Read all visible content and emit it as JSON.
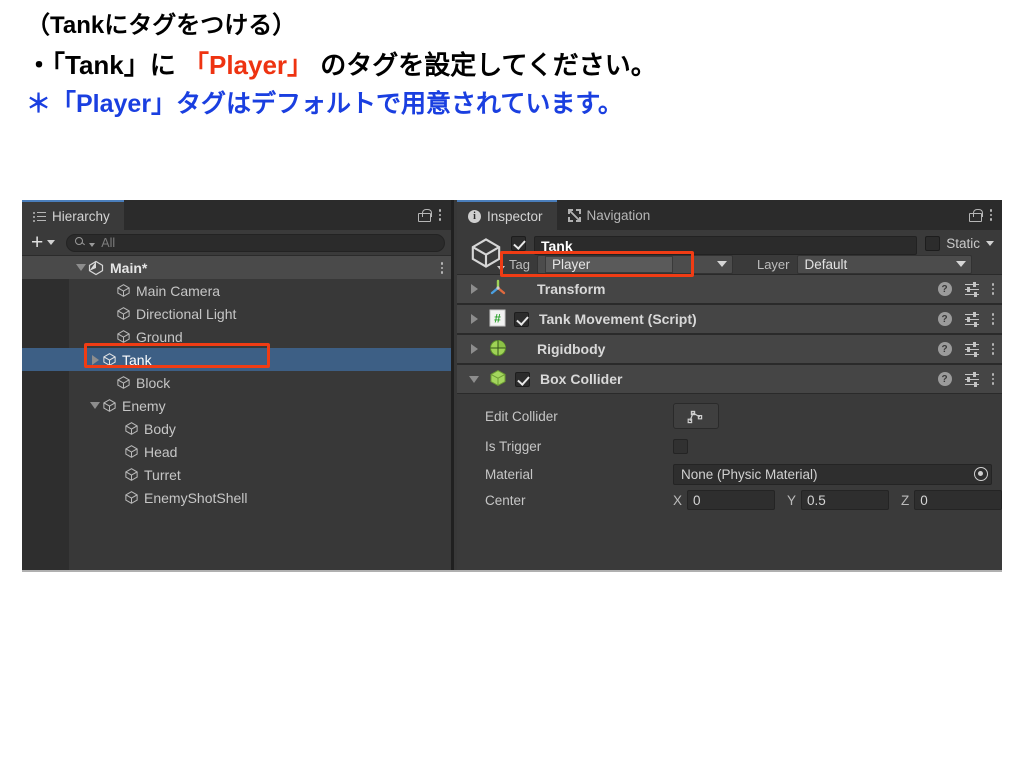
{
  "slide": {
    "line1": "（Tankにタグをつける）",
    "line2_pre": "・「Tank」に ",
    "line2_red": "「Player」",
    "line2_post": " のタグを設定してください。",
    "line3": "＊「Player」タグはデフォルトで用意されています。",
    "red_color": "#ee3311",
    "blue_color": "#1a3fe0"
  },
  "hierarchy": {
    "tab_label": "Hierarchy",
    "tab_icon": "list-icon",
    "lock_icon": "lock-icon",
    "menu_icon": "kebab-menu-icon",
    "create_label": "+",
    "search_placeholder": "All",
    "search_value": "",
    "scene": {
      "label": "Main*",
      "expanded": true
    },
    "items": [
      {
        "label": "Main Camera",
        "indent": 1,
        "arrow": "none"
      },
      {
        "label": "Directional Light",
        "indent": 1,
        "arrow": "none"
      },
      {
        "label": "Ground",
        "indent": 1,
        "arrow": "none"
      },
      {
        "label": "Tank",
        "indent": 1,
        "arrow": "right",
        "selected": true,
        "highlighted": true
      },
      {
        "label": "Block",
        "indent": 1,
        "arrow": "none"
      },
      {
        "label": "Enemy",
        "indent": 1,
        "arrow": "down"
      },
      {
        "label": "Body",
        "indent": 2,
        "arrow": "none"
      },
      {
        "label": "Head",
        "indent": 2,
        "arrow": "none"
      },
      {
        "label": "Turret",
        "indent": 2,
        "arrow": "none"
      },
      {
        "label": "EnemyShotShell",
        "indent": 2,
        "arrow": "none"
      }
    ],
    "selection_color": "#3d5f85",
    "highlight_color": "#f03c14"
  },
  "inspector": {
    "tabs": [
      {
        "label": "Inspector",
        "icon": "info-icon",
        "active": true
      },
      {
        "label": "Navigation",
        "icon": "navigation-icon",
        "active": false
      }
    ],
    "lock_icon": "lock-icon",
    "menu_icon": "kebab-menu-icon",
    "object": {
      "enabled": true,
      "name": "Tank",
      "static_label": "Static",
      "static_checked": false,
      "tag_label": "Tag",
      "tag_value": "Player",
      "layer_label": "Layer",
      "layer_value": "Default",
      "tag_highlighted": true
    },
    "components": [
      {
        "name": "Transform",
        "icon": "transform-icon",
        "expanded": false,
        "has_checkbox": false
      },
      {
        "name": "Tank Movement (Script)",
        "icon": "script-icon",
        "expanded": false,
        "has_checkbox": true,
        "checked": true
      },
      {
        "name": "Rigidbody",
        "icon": "rigidbody-icon",
        "expanded": false,
        "has_checkbox": false
      },
      {
        "name": "Box Collider",
        "icon": "boxcollider-icon",
        "expanded": true,
        "has_checkbox": true,
        "checked": true
      }
    ],
    "row_icons": {
      "help": "help-icon",
      "preset": "preset-icon",
      "menu": "kebab-menu-icon"
    },
    "box_collider": {
      "edit_collider_label": "Edit Collider",
      "edit_collider_icon": "edit-collider-icon",
      "is_trigger_label": "Is Trigger",
      "is_trigger_checked": false,
      "material_label": "Material",
      "material_value": "None (Physic Material)",
      "material_picker_icon": "object-picker-icon",
      "center_label": "Center",
      "center": {
        "x_label": "X",
        "x": "0",
        "y_label": "Y",
        "y": "0.5",
        "z_label": "Z",
        "z": "0"
      }
    }
  }
}
